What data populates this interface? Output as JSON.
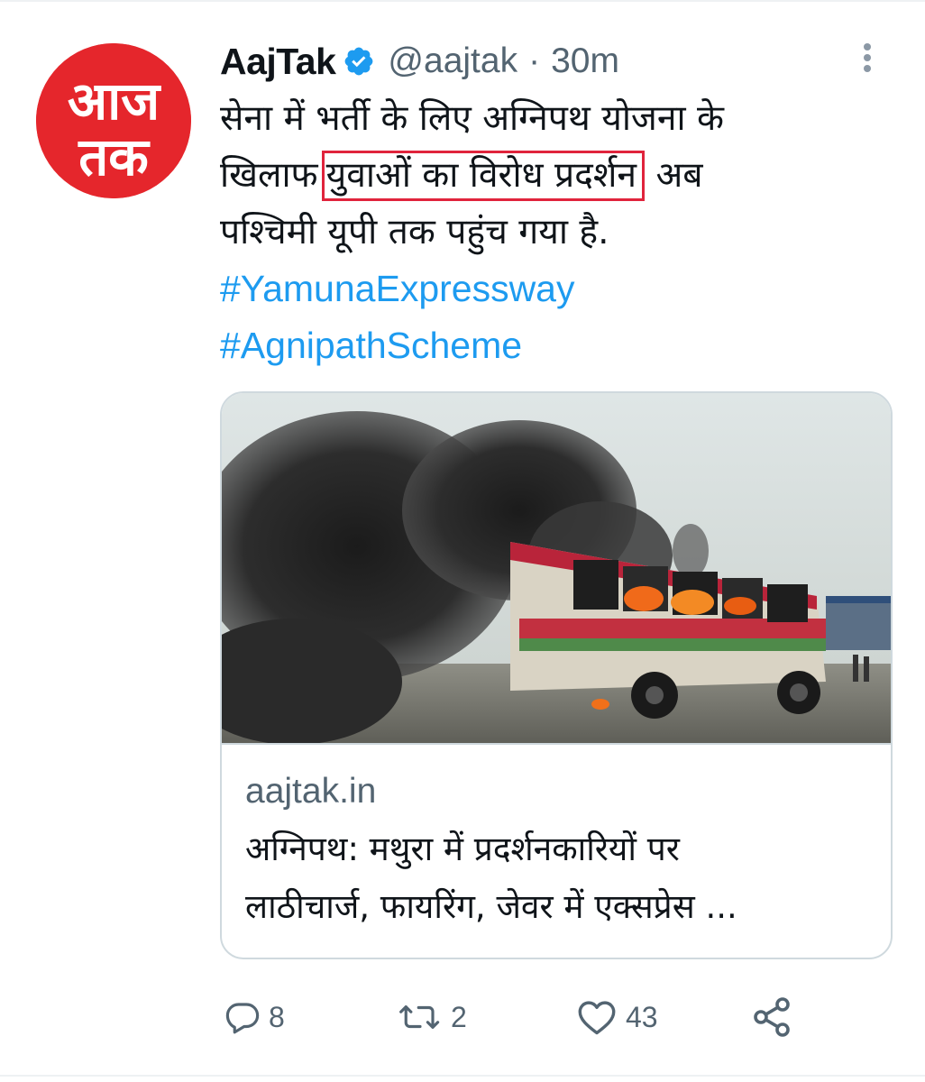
{
  "tweet": {
    "display_name": "AajTak",
    "handle": "@aajtak",
    "separator": "·",
    "time": "30m",
    "avatar_text": "आज तक",
    "text": {
      "line1": "सेना में भर्ती के लिए अग्निपथ योजना के",
      "line2_before": "खिलाफ",
      "line2_highlight": "युवाओं का विरोध प्रदर्शन",
      "line2_after": "अब",
      "line3": "पश्चिमी यूपी तक पहुंच गया है."
    },
    "hashtags": [
      "#YamunaExpressway",
      "#AgnipathScheme"
    ]
  },
  "card": {
    "domain": "aajtak.in",
    "title_line1": "अग्निपथ: मथुरा में प्रदर्शनकारियों पर",
    "title_line2": "लाठीचार्ज, फायरिंग, जेवर में एक्सप्रेस ..."
  },
  "actions": {
    "reply_count": "8",
    "retweet_count": "2",
    "like_count": "43"
  },
  "colors": {
    "accent": "#1d9bf0",
    "brand_red": "#e5262c",
    "highlight_box": "#e0243c",
    "muted_text": "#536471"
  },
  "icons": [
    "verified-badge-icon",
    "more-options-icon",
    "reply-icon",
    "retweet-icon",
    "like-icon",
    "share-icon"
  ]
}
